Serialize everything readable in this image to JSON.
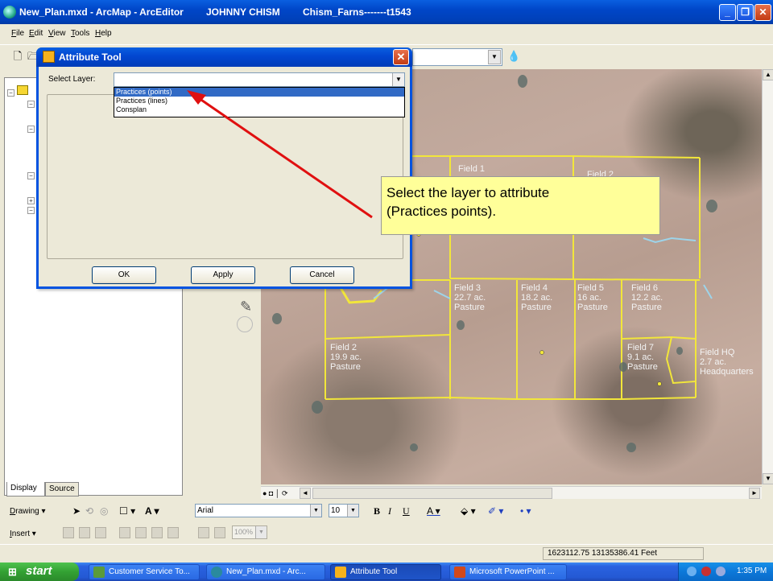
{
  "window": {
    "title_file": "New_Plan.mxd - ArcMap - ArcEditor",
    "title_user": "JOHNNY CHISM",
    "title_farm": "Chism_Farns-------t1543",
    "minimize_label": "_",
    "maximize_label": "❐",
    "close_label": "✕"
  },
  "menu": [
    "File",
    "Edit",
    "View",
    "Tools",
    "Help"
  ],
  "toc": {
    "tabs": [
      "Display",
      "Source"
    ]
  },
  "dialog": {
    "title": "Attribute Tool",
    "close_label": "✕",
    "select_layer_label": "Select Layer:",
    "select_value": "",
    "options": [
      "Practices (points)",
      "Practices (lines)",
      "Consplan"
    ],
    "selected_index": 0,
    "buttons": {
      "ok": "OK",
      "apply": "Apply",
      "cancel": "Cancel"
    }
  },
  "callout": {
    "text": "Select the layer to attribute\n(Practices points)."
  },
  "map": {
    "fields": [
      {
        "id": "field-1",
        "label": "Field  1"
      },
      {
        "id": "field-2top",
        "label": "Field  2"
      },
      {
        "id": "field-3",
        "label": "Field  3\n22.7 ac.\nPasture"
      },
      {
        "id": "field-4",
        "label": "Field  4\n18.2 ac.\nPasture"
      },
      {
        "id": "field-5",
        "label": "Field  5\n16 ac.\nPasture"
      },
      {
        "id": "field-6",
        "label": "Field  6\n12.2 ac.\nPasture"
      },
      {
        "id": "field-2",
        "label": "Field  2\n19.9 ac.\nPasture"
      },
      {
        "id": "field-7",
        "label": "Field  7\n9.1 ac.\nPasture"
      },
      {
        "id": "field-hq",
        "label": "Field  HQ\n2.7 ac.\nHeadquarters"
      }
    ],
    "boundary_color": "#f2e63a"
  },
  "drawing": {
    "label": "Drawing ▾",
    "font_name": "Arial",
    "font_size": "10",
    "bold": "B",
    "italic": "I",
    "underline": "U"
  },
  "insert": {
    "label": "Insert ▾",
    "zoom": "100%"
  },
  "status": {
    "coordinates": "1623112.75  13135386.41 Feet"
  },
  "taskbar": {
    "start_label": "start",
    "tasks": [
      {
        "label": "Customer Service To...",
        "color": "#5b9b3a"
      },
      {
        "label": "New_Plan.mxd - Arc...",
        "color": "#2a8a9e"
      },
      {
        "label": "Attribute Tool",
        "color": "#f6b21c"
      },
      {
        "label": "Microsoft PowerPoint ...",
        "color": "#d2491b"
      }
    ],
    "clock": "1:35 PM"
  }
}
